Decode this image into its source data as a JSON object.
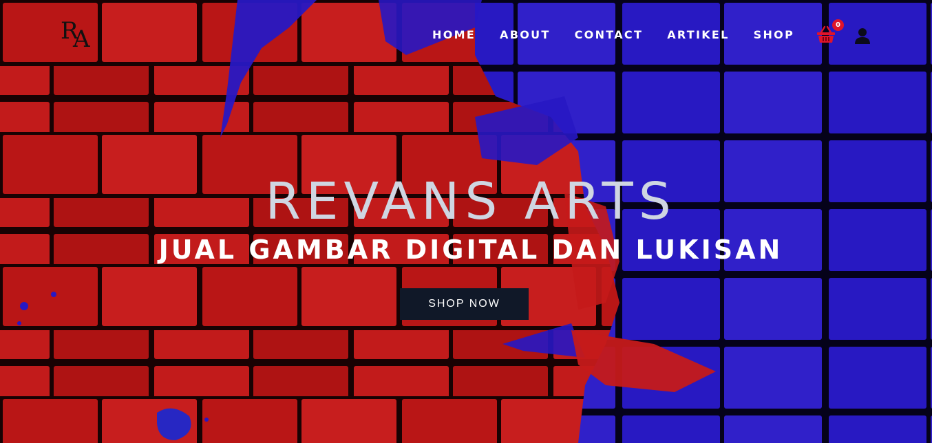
{
  "logo": {
    "letter1": "R",
    "letter2": "A"
  },
  "nav": {
    "items": [
      {
        "label": "HOME"
      },
      {
        "label": "ABOUT"
      },
      {
        "label": "CONTACT"
      },
      {
        "label": "ARTIKEL"
      },
      {
        "label": "SHOP"
      }
    ]
  },
  "cart": {
    "count": "0",
    "icon": "shopping-basket-icon"
  },
  "user": {
    "icon": "user-icon"
  },
  "hero": {
    "title": "REVANS ARTS",
    "subtitle": "JUAL GAMBAR DIGITAL DAN LUKISAN",
    "cta_label": "SHOP NOW"
  },
  "colors": {
    "brick_red": "#c81a1a",
    "brick_blue": "#2a1ad0",
    "button_bg": "#101828",
    "cart_red": "#e0142a",
    "title_text": "#cfd6e2"
  }
}
